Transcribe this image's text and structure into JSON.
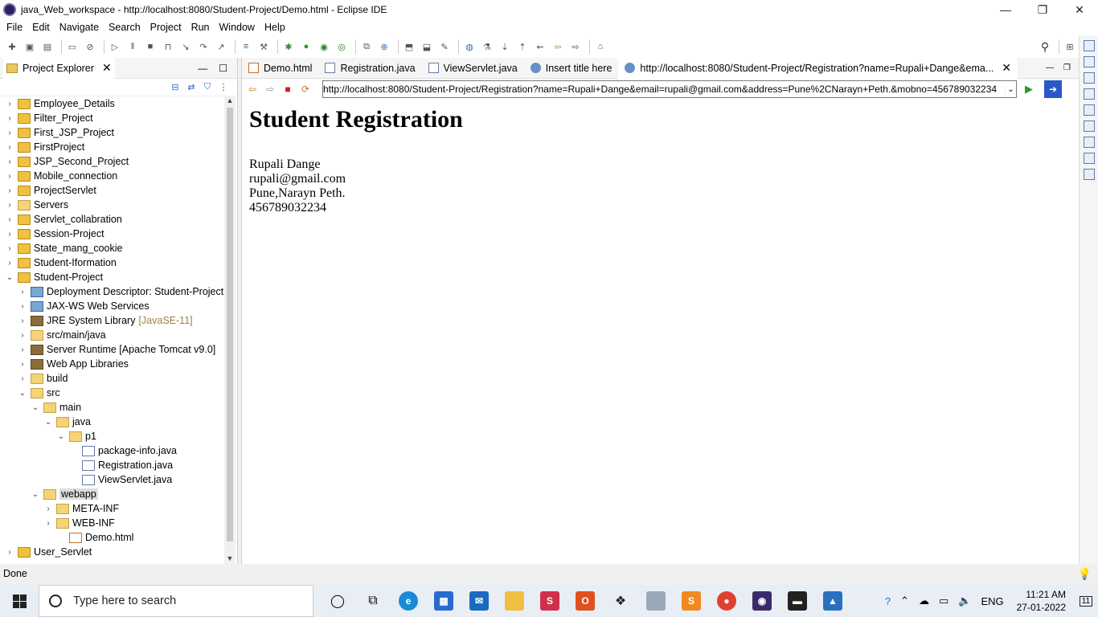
{
  "window": {
    "title": "java_Web_workspace - http://localhost:8080/Student-Project/Demo.html - Eclipse IDE",
    "min": "—",
    "restore": "❐",
    "close": "✕"
  },
  "menu": [
    "File",
    "Edit",
    "Navigate",
    "Search",
    "Project",
    "Run",
    "Window",
    "Help"
  ],
  "explorer": {
    "tab_label": "Project Explorer",
    "close": "✕",
    "minimize": "—",
    "maximize": "☐",
    "tree": [
      {
        "label": "Employee_Details",
        "level": 0,
        "chev": "›",
        "icon": "proj"
      },
      {
        "label": "Filter_Project",
        "level": 0,
        "chev": "›",
        "icon": "proj"
      },
      {
        "label": "First_JSP_Project",
        "level": 0,
        "chev": "›",
        "icon": "proj"
      },
      {
        "label": "FirstProject",
        "level": 0,
        "chev": "›",
        "icon": "proj"
      },
      {
        "label": "JSP_Second_Project",
        "level": 0,
        "chev": "›",
        "icon": "proj"
      },
      {
        "label": "Mobile_connection",
        "level": 0,
        "chev": "›",
        "icon": "proj"
      },
      {
        "label": "ProjectServlet",
        "level": 0,
        "chev": "›",
        "icon": "proj"
      },
      {
        "label": "Servers",
        "level": 0,
        "chev": "›",
        "icon": "folder"
      },
      {
        "label": "Servlet_collabration",
        "level": 0,
        "chev": "›",
        "icon": "proj"
      },
      {
        "label": "Session-Project",
        "level": 0,
        "chev": "›",
        "icon": "proj"
      },
      {
        "label": "State_mang_cookie",
        "level": 0,
        "chev": "›",
        "icon": "proj"
      },
      {
        "label": "Student-Iformation",
        "level": 0,
        "chev": "›",
        "icon": "proj"
      },
      {
        "label": "Student-Project",
        "level": 0,
        "chev": "⌄",
        "icon": "proj"
      },
      {
        "label": "Deployment Descriptor: Student-Project",
        "level": 1,
        "chev": "›",
        "icon": "dd"
      },
      {
        "label": "JAX-WS Web Services",
        "level": 1,
        "chev": "›",
        "icon": "dd"
      },
      {
        "label": "JRE System Library",
        "suffix": "[JavaSE-11]",
        "level": 1,
        "chev": "›",
        "icon": "lib"
      },
      {
        "label": "src/main/java",
        "level": 1,
        "chev": "›",
        "icon": "folder"
      },
      {
        "label": "Server Runtime [Apache Tomcat v9.0]",
        "level": 1,
        "chev": "›",
        "icon": "lib"
      },
      {
        "label": "Web App Libraries",
        "level": 1,
        "chev": "›",
        "icon": "lib"
      },
      {
        "label": "build",
        "level": 1,
        "chev": "›",
        "icon": "folder"
      },
      {
        "label": "src",
        "level": 1,
        "chev": "⌄",
        "icon": "folder"
      },
      {
        "label": "main",
        "level": 2,
        "chev": "⌄",
        "icon": "folder"
      },
      {
        "label": "java",
        "level": 3,
        "chev": "⌄",
        "icon": "folder"
      },
      {
        "label": "p1",
        "level": 4,
        "chev": "⌄",
        "icon": "folder"
      },
      {
        "label": "package-info.java",
        "level": 5,
        "chev": "",
        "icon": "jfile"
      },
      {
        "label": "Registration.java",
        "level": 5,
        "chev": "",
        "icon": "jfile"
      },
      {
        "label": "ViewServlet.java",
        "level": 5,
        "chev": "",
        "icon": "jfile"
      },
      {
        "label": "webapp",
        "level": 2,
        "chev": "⌄",
        "icon": "folder",
        "selected": true
      },
      {
        "label": "META-INF",
        "level": 3,
        "chev": "›",
        "icon": "folder"
      },
      {
        "label": "WEB-INF",
        "level": 3,
        "chev": "›",
        "icon": "folder"
      },
      {
        "label": "Demo.html",
        "level": 4,
        "chev": "",
        "icon": "hfile"
      },
      {
        "label": "User_Servlet",
        "level": 0,
        "chev": "›",
        "icon": "proj"
      }
    ]
  },
  "editor": {
    "tabs": [
      {
        "label": "Demo.html",
        "icon": "hfile",
        "active": false
      },
      {
        "label": "Registration.java",
        "icon": "jfile",
        "active": false
      },
      {
        "label": "ViewServlet.java",
        "icon": "jfile",
        "active": false
      },
      {
        "label": "Insert title here",
        "icon": "globe",
        "active": false
      },
      {
        "label": "http://localhost:8080/Student-Project/Registration?name=Rupali+Dange&ema...",
        "icon": "globe",
        "active": true,
        "close": "✕"
      }
    ],
    "url": "http://localhost:8080/Student-Project/Registration?name=Rupali+Dange&email=rupali@gmail.com&address=Pune%2CNarayn+Peth.&mobno=456789032234"
  },
  "page": {
    "heading": "Student Registration",
    "lines": [
      "Rupali Dange",
      "rupali@gmail.com",
      "Pune,Narayn Peth.",
      "456789032234"
    ]
  },
  "status": {
    "text": "Done"
  },
  "taskbar": {
    "search_placeholder": "Type here to search",
    "lang": "ENG",
    "time": "11:21 AM",
    "date": "27-01-2022",
    "notifications": "11"
  }
}
